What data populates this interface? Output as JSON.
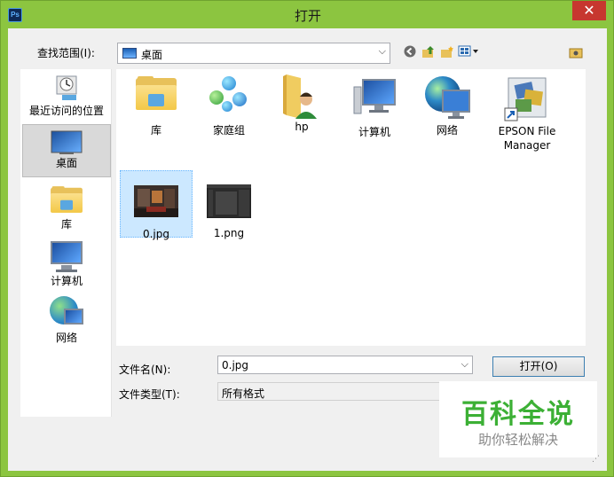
{
  "window": {
    "app_icon_text": "Ps",
    "title": "打开",
    "close_glyph": "✕"
  },
  "lookin": {
    "label": "查找范围(I):",
    "value": "桌面",
    "arrow": "⌵"
  },
  "toolbar": {
    "icons": [
      "back-icon",
      "up-folder-icon",
      "new-folder-icon",
      "view-menu-icon",
      "preview-icon"
    ]
  },
  "places": [
    {
      "label": "最近访问的位置",
      "icon": "recent-places-icon"
    },
    {
      "label": "桌面",
      "icon": "desktop-icon",
      "selected": true
    },
    {
      "label": "库",
      "icon": "library-icon"
    },
    {
      "label": "计算机",
      "icon": "computer-icon"
    },
    {
      "label": "网络",
      "icon": "network-icon"
    }
  ],
  "files": [
    {
      "label": "库",
      "icon": "library-folder-icon"
    },
    {
      "label": "家庭组",
      "icon": "homegroup-icon"
    },
    {
      "label": "hp",
      "icon": "user-folder-icon"
    },
    {
      "label": "计算机",
      "icon": "computer-icon"
    },
    {
      "label": "网络",
      "icon": "network-icon"
    },
    {
      "label": "EPSON File Manager",
      "icon": "epson-shortcut-icon"
    },
    {
      "label": "0.jpg",
      "icon": "image-thumbnail",
      "selected": true
    },
    {
      "label": "1.png",
      "icon": "image-thumbnail"
    }
  ],
  "filename": {
    "label": "文件名(N):",
    "value": "0.jpg"
  },
  "filetype": {
    "label": "文件类型(T):",
    "value": "所有格式"
  },
  "buttons": {
    "open": "打开(O)"
  },
  "watermark": {
    "brand": "百科全说",
    "tagline": "助你轻松解决"
  },
  "colors": {
    "frame": "#8cc540",
    "close": "#c7372f",
    "selection": "#cce8ff",
    "watermark_green": "#3cb035"
  }
}
